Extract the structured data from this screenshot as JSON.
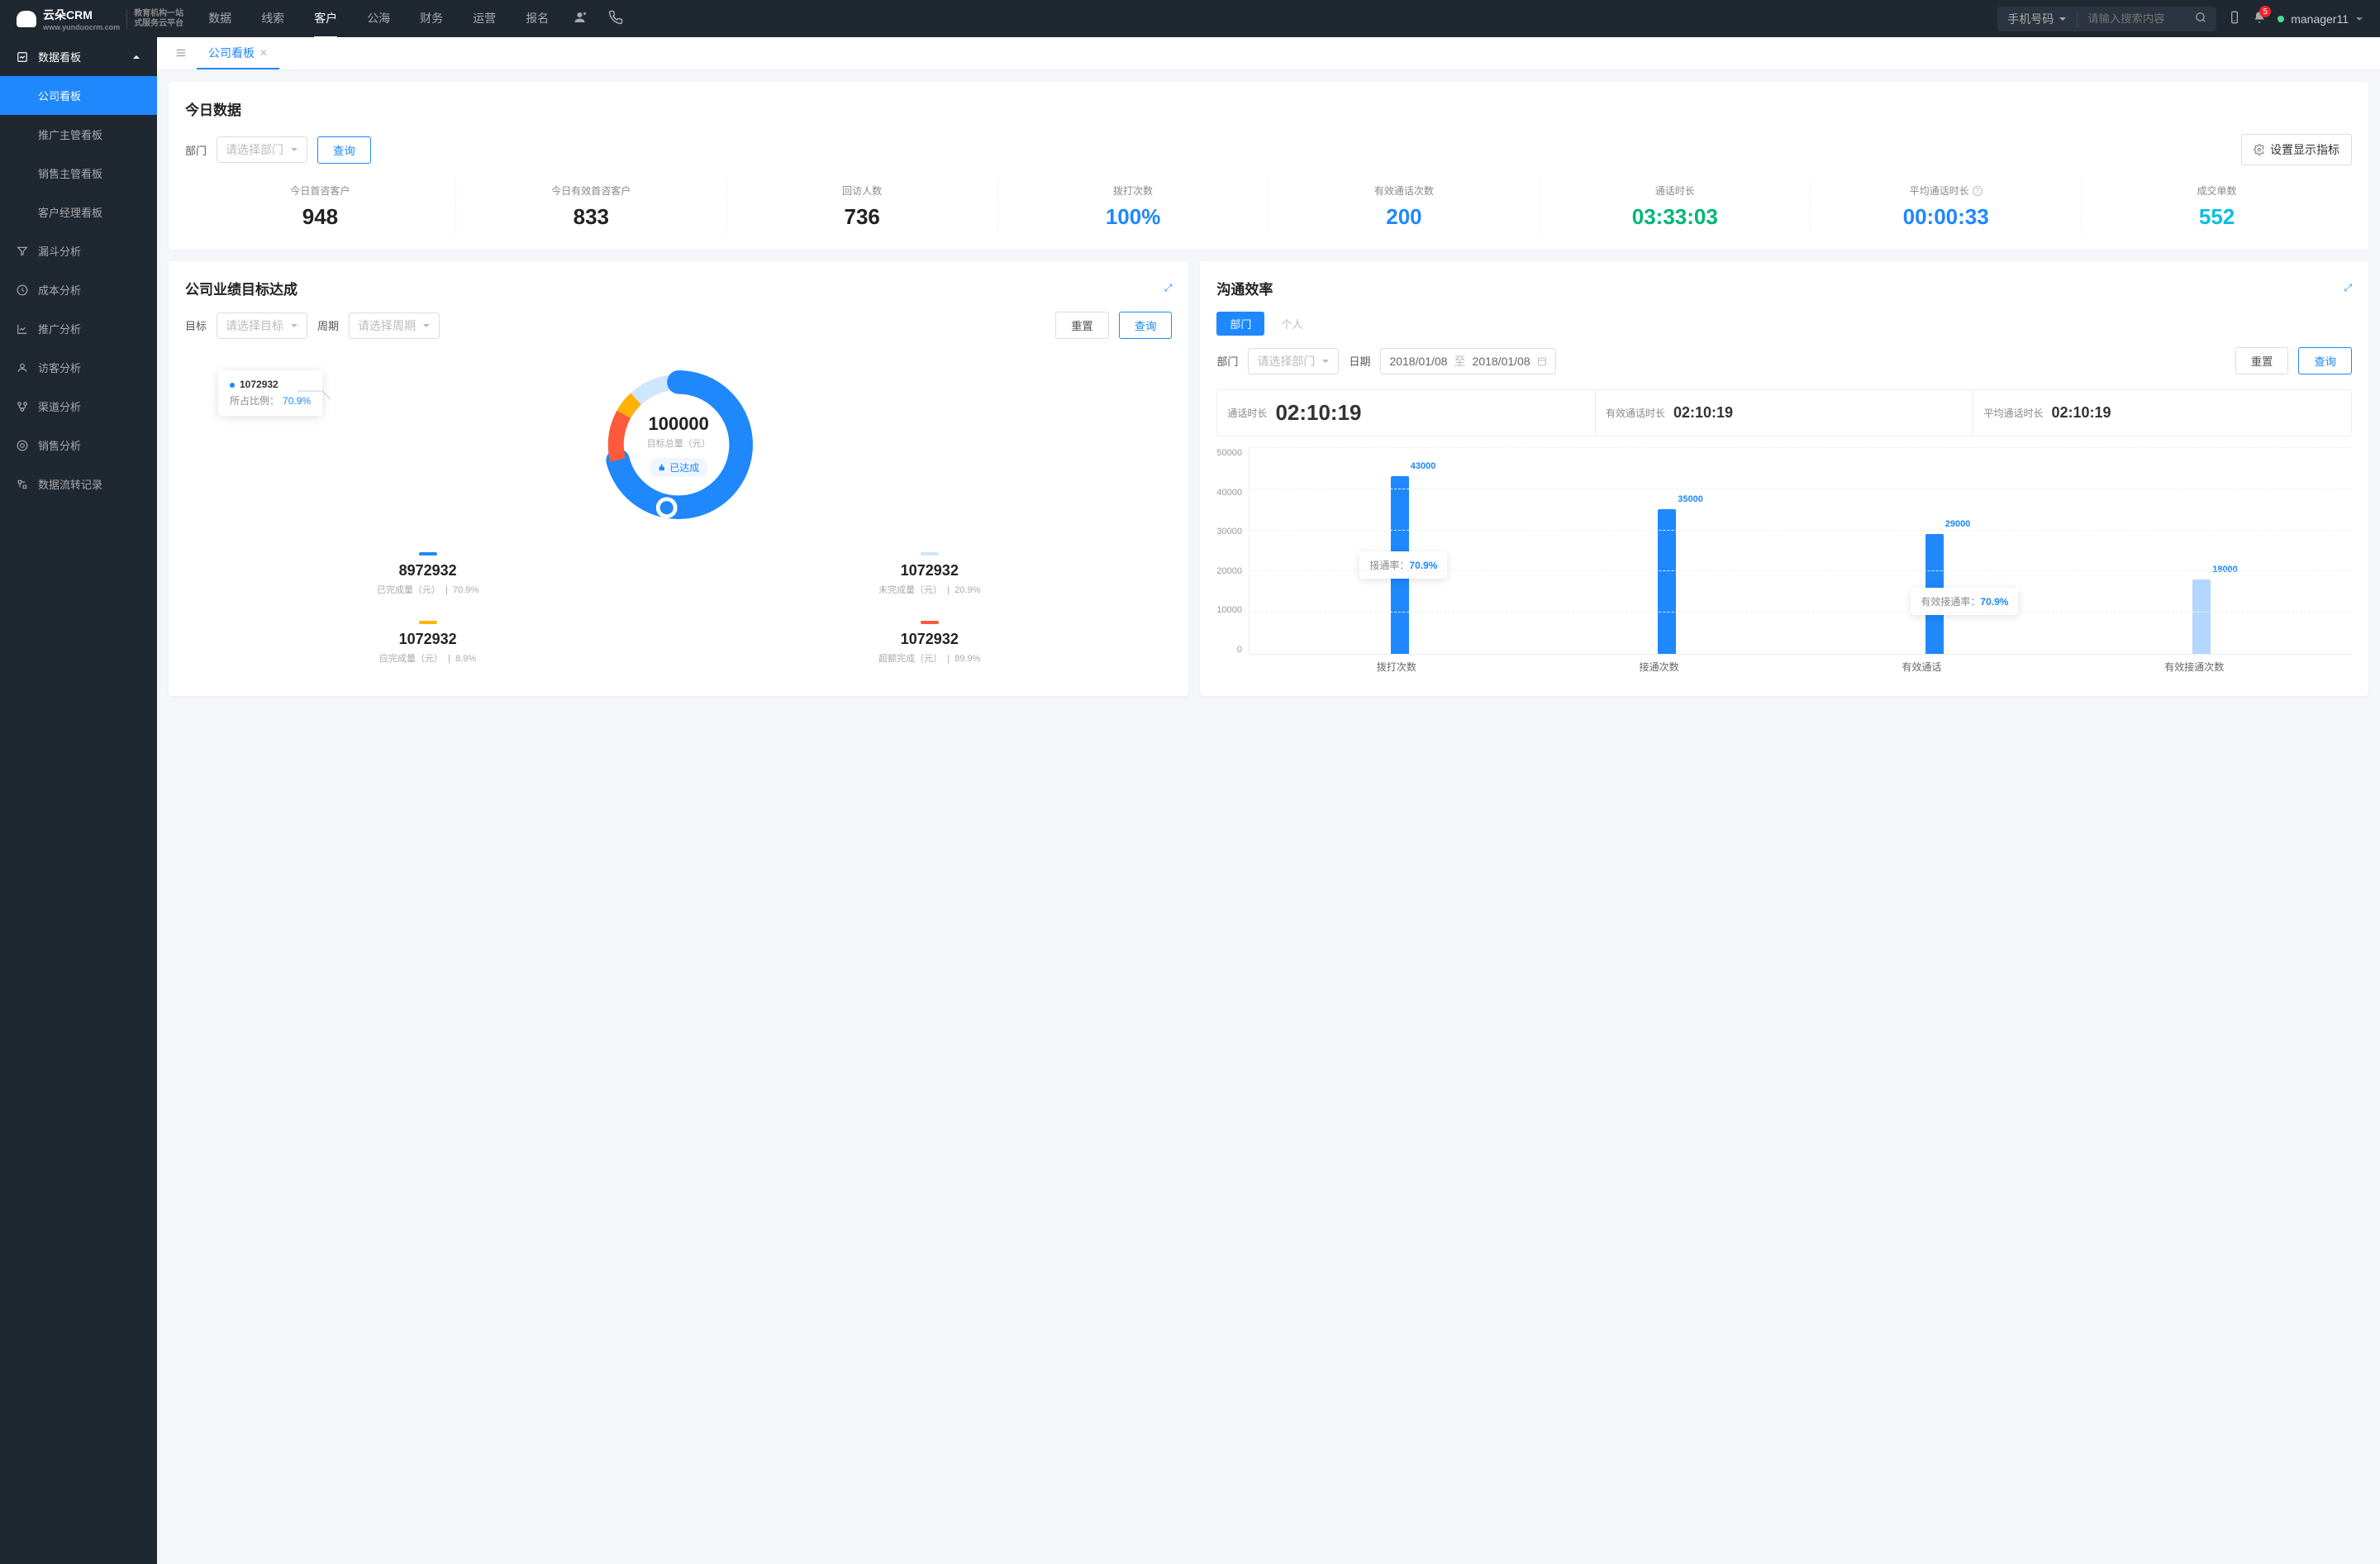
{
  "header": {
    "logo_text": "云朵CRM",
    "logo_url": "www.yunduocrm.com",
    "logo_tag1": "教育机构一站",
    "logo_tag2": "式服务云平台",
    "nav": [
      "数据",
      "线索",
      "客户",
      "公海",
      "财务",
      "运营",
      "报名"
    ],
    "nav_active_index": 2,
    "search_type": "手机号码",
    "search_placeholder": "请输入搜索内容",
    "notif_count": "5",
    "user": "manager11"
  },
  "sidebar": {
    "group": {
      "label": "数据看板",
      "expanded": true
    },
    "subs": [
      {
        "label": "公司看板",
        "active": true
      },
      {
        "label": "推广主管看板"
      },
      {
        "label": "销售主管看板"
      },
      {
        "label": "客户经理看板"
      }
    ],
    "items": [
      {
        "label": "漏斗分析",
        "icon": "funnel"
      },
      {
        "label": "成本分析",
        "icon": "clock"
      },
      {
        "label": "推广分析",
        "icon": "chart"
      },
      {
        "label": "访客分析",
        "icon": "visitor"
      },
      {
        "label": "渠道分析",
        "icon": "channel"
      },
      {
        "label": "销售分析",
        "icon": "target"
      },
      {
        "label": "数据流转记录",
        "icon": "flow"
      }
    ]
  },
  "tabs": {
    "active": "公司看板"
  },
  "today": {
    "title": "今日数据",
    "dept_label": "部门",
    "dept_placeholder": "请选择部门",
    "query": "查询",
    "settings": "设置显示指标",
    "stats": [
      {
        "label": "今日首咨客户",
        "value": "948",
        "cls": "c-dark"
      },
      {
        "label": "今日有效首咨客户",
        "value": "833",
        "cls": "c-dark"
      },
      {
        "label": "回访人数",
        "value": "736",
        "cls": "c-dark"
      },
      {
        "label": "拨打次数",
        "value": "100%",
        "cls": "c-blue"
      },
      {
        "label": "有效通话次数",
        "value": "200",
        "cls": "c-blue"
      },
      {
        "label": "通话时长",
        "value": "03:33:03",
        "cls": "c-green"
      },
      {
        "label": "平均通话时长",
        "value": "00:00:33",
        "cls": "c-blue",
        "info": true
      },
      {
        "label": "成交单数",
        "value": "552",
        "cls": "c-cyan"
      }
    ]
  },
  "goal": {
    "title": "公司业绩目标达成",
    "target_label": "目标",
    "target_placeholder": "请选择目标",
    "period_label": "周期",
    "period_placeholder": "请选择周期",
    "reset": "重置",
    "query": "查询",
    "center_value": "100000",
    "center_sub": "目标总量（元）",
    "center_badge": "已达成",
    "tooltip_value": "1072932",
    "tooltip_pct_label": "所占比例：",
    "tooltip_pct": "70.9%",
    "legend": [
      {
        "value": "8972932",
        "label": "已完成量（元）",
        "pct": "70.9%",
        "color": "#1e88fc"
      },
      {
        "value": "1072932",
        "label": "未完成量（元）",
        "pct": "20.9%",
        "color": "#cfe6ff"
      },
      {
        "value": "1072932",
        "label": "应完成量（元）",
        "pct": "8.9%",
        "color": "#ffb300"
      },
      {
        "value": "1072932",
        "label": "超额完成（元）",
        "pct": "89.9%",
        "color": "#ff5a3c"
      }
    ]
  },
  "comm": {
    "title": "沟通效率",
    "seg_dept": "部门",
    "seg_personal": "个人",
    "dept_label": "部门",
    "dept_placeholder": "请选择部门",
    "date_label": "日期",
    "date_from": "2018/01/08",
    "date_to": "至",
    "date_end": "2018/01/08",
    "reset": "重置",
    "query": "查询",
    "times": [
      {
        "label": "通话时长",
        "value": "02:10:19"
      },
      {
        "label": "有效通话时长",
        "value": "02:10:19"
      },
      {
        "label": "平均通话时长",
        "value": "02:10:19"
      }
    ],
    "tip1_label": "接通率：",
    "tip1_value": "70.9%",
    "tip2_label": "有效接通率：",
    "tip2_value": "70.9%"
  },
  "chart_data": {
    "type": "bar",
    "categories": [
      "拨打次数",
      "接通次数",
      "有效通话",
      "有效接通次数"
    ],
    "series": [
      {
        "name": "main",
        "values": [
          43000,
          35000,
          29000,
          18000
        ]
      }
    ],
    "value_labels": [
      "43000",
      "35000",
      "29000",
      "18000"
    ],
    "ylim": [
      0,
      50000
    ],
    "y_ticks": [
      "50000",
      "40000",
      "30000",
      "20000",
      "10000",
      "0"
    ],
    "xlabel": "",
    "ylabel": "",
    "annotations": [
      {
        "label": "接通率：",
        "value": "70.9%",
        "between": [
          0,
          1
        ]
      },
      {
        "label": "有效接通率：",
        "value": "70.9%",
        "between": [
          2,
          3
        ]
      }
    ]
  }
}
